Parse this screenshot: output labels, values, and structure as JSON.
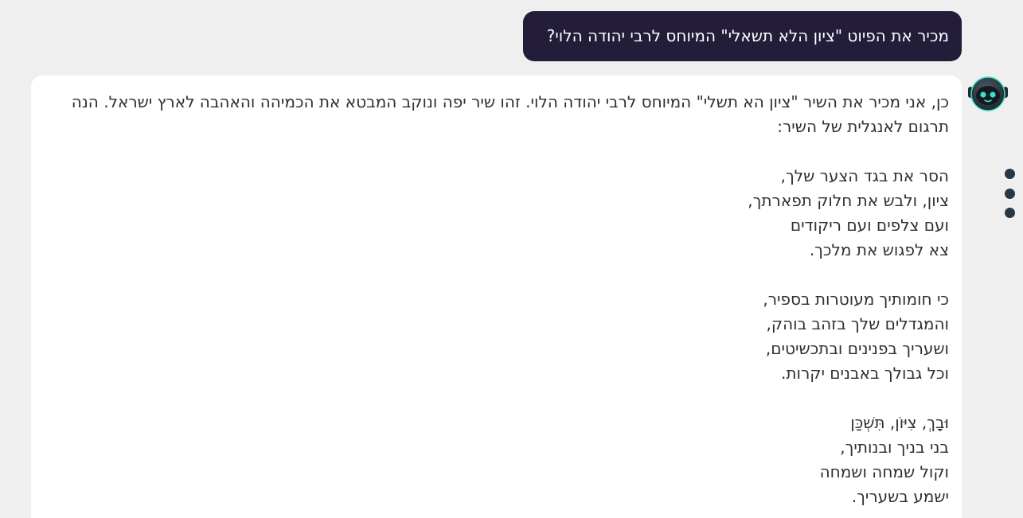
{
  "user_message": "מכיר את הפיוט \"ציון הלא תשאלי\" המיוחס לרבי יהודה הלוי?",
  "assistant": {
    "intro_line_1": "כן, אני מכיר את השיר \"ציון הא תשלי\" המיוחס לרבי יהודה הלוי. זהו שיר יפה ונוקב המבטא את הכמיהה והאהבה לארץ ישראל. הנה",
    "intro_line_2": "תרגום לאנגלית של השיר:",
    "stanzas": [
      {
        "lines": [
          "הסר את בגד הצער שלך,",
          "ציון, ולבש את חלוק תפארתך,",
          "ועם צלפים ועם ריקודים",
          "צא לפגוש את מלכך."
        ]
      },
      {
        "lines": [
          "כי חומותיך מעוטרות בספיר,",
          "והמגדלים שלך בזהב בוהק,",
          "ושעריך בפנינים ובתכשיטים,",
          "וכל גבולך באבנים יקרות."
        ]
      },
      {
        "lines": [
          "וּבָךְ, צִיּוֹן, תִּשְׁכַּן",
          "בני בניך ובנותיך,",
          "וקול שמחה ושמחה",
          "ישמע בשעריך."
        ]
      }
    ]
  },
  "icons": {
    "avatar": "robot-avatar-icon",
    "menu": "vertical-dots-menu-icon"
  },
  "colors": {
    "page_background": "#efefef",
    "user_bubble": "#231d3a",
    "assistant_bubble": "#ffffff",
    "avatar_eye_glow": "#37e0c8",
    "menu_dots": "#263746"
  }
}
